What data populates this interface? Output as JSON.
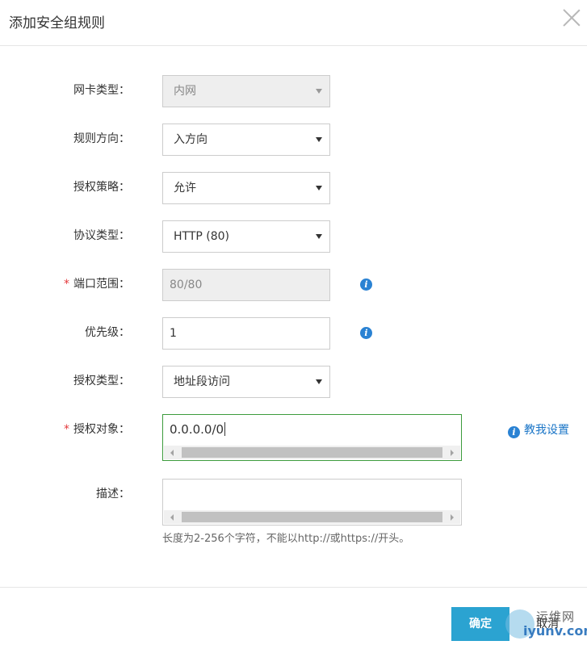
{
  "dialog": {
    "title": "添加安全组规则",
    "close_icon": "close-icon"
  },
  "form": {
    "nic_type": {
      "label": "网卡类型：",
      "value": "内网",
      "disabled": true
    },
    "direction": {
      "label": "规则方向：",
      "value": "入方向"
    },
    "policy": {
      "label": "授权策略：",
      "value": "允许"
    },
    "protocol": {
      "label": "协议类型：",
      "value": "HTTP (80)"
    },
    "port_range": {
      "label": "端口范围：",
      "required_mark": "*",
      "value": "80/80",
      "disabled": true
    },
    "priority": {
      "label": "优先级：",
      "value": "1"
    },
    "auth_type": {
      "label": "授权类型：",
      "value": "地址段访问"
    },
    "auth_object": {
      "label": "授权对象：",
      "required_mark": "*",
      "value": "0.0.0.0/0"
    },
    "description": {
      "label": "描述：",
      "value": ""
    },
    "help_link": "教我设置",
    "hint": "长度为2-256个字符，不能以http://或https://开头。"
  },
  "info_glyph": "i",
  "footer": {
    "ok_label": "确定",
    "cancel_label": "取消"
  },
  "watermark": {
    "top": "运维网",
    "bottom": "iyunv.com"
  },
  "colors": {
    "primary": "#2ba3d1",
    "link": "#1a75c7",
    "required": "#e4393c",
    "focus_border": "#3c9b3c"
  }
}
